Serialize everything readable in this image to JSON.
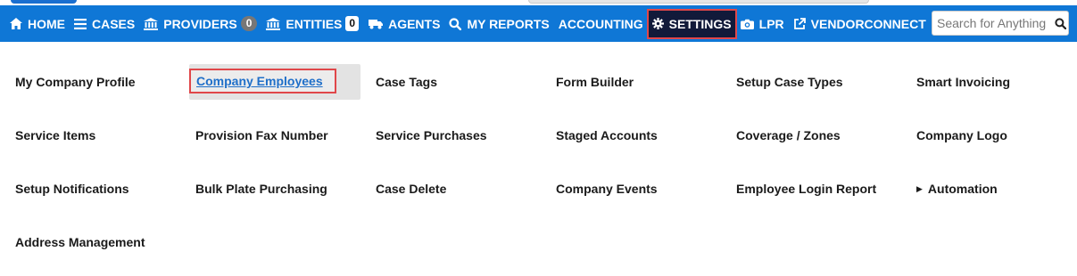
{
  "nav": {
    "home": "HOME",
    "cases": "CASES",
    "providers": "PROVIDERS",
    "providers_count": "0",
    "entities": "ENTITIES",
    "entities_count": "0",
    "agents": "AGENTS",
    "my_reports": "MY REPORTS",
    "accounting": "ACCOUNTING",
    "settings": "SETTINGS",
    "lpr": "LPR",
    "vendorconnect": "VENDORCONNECT"
  },
  "search": {
    "placeholder": "Search for Anything"
  },
  "colors": {
    "nav_bg": "#0f77d6",
    "active_bg": "#111a3a",
    "highlight_border": "#e0474a",
    "link": "#1f6fc9"
  },
  "settings_menu": {
    "rows": [
      [
        "My Company Profile",
        "Company Employees",
        "Case Tags",
        "Form Builder",
        "Setup Case Types",
        "Smart Invoicing"
      ],
      [
        "Service Items",
        "Provision Fax Number",
        "Service Purchases",
        "Staged Accounts",
        "Coverage / Zones",
        "Company Logo"
      ],
      [
        "Setup Notifications",
        "Bulk Plate Purchasing",
        "Case Delete",
        "Company Events",
        "Employee Login Report",
        "Automation"
      ],
      [
        "Address Management"
      ]
    ]
  }
}
